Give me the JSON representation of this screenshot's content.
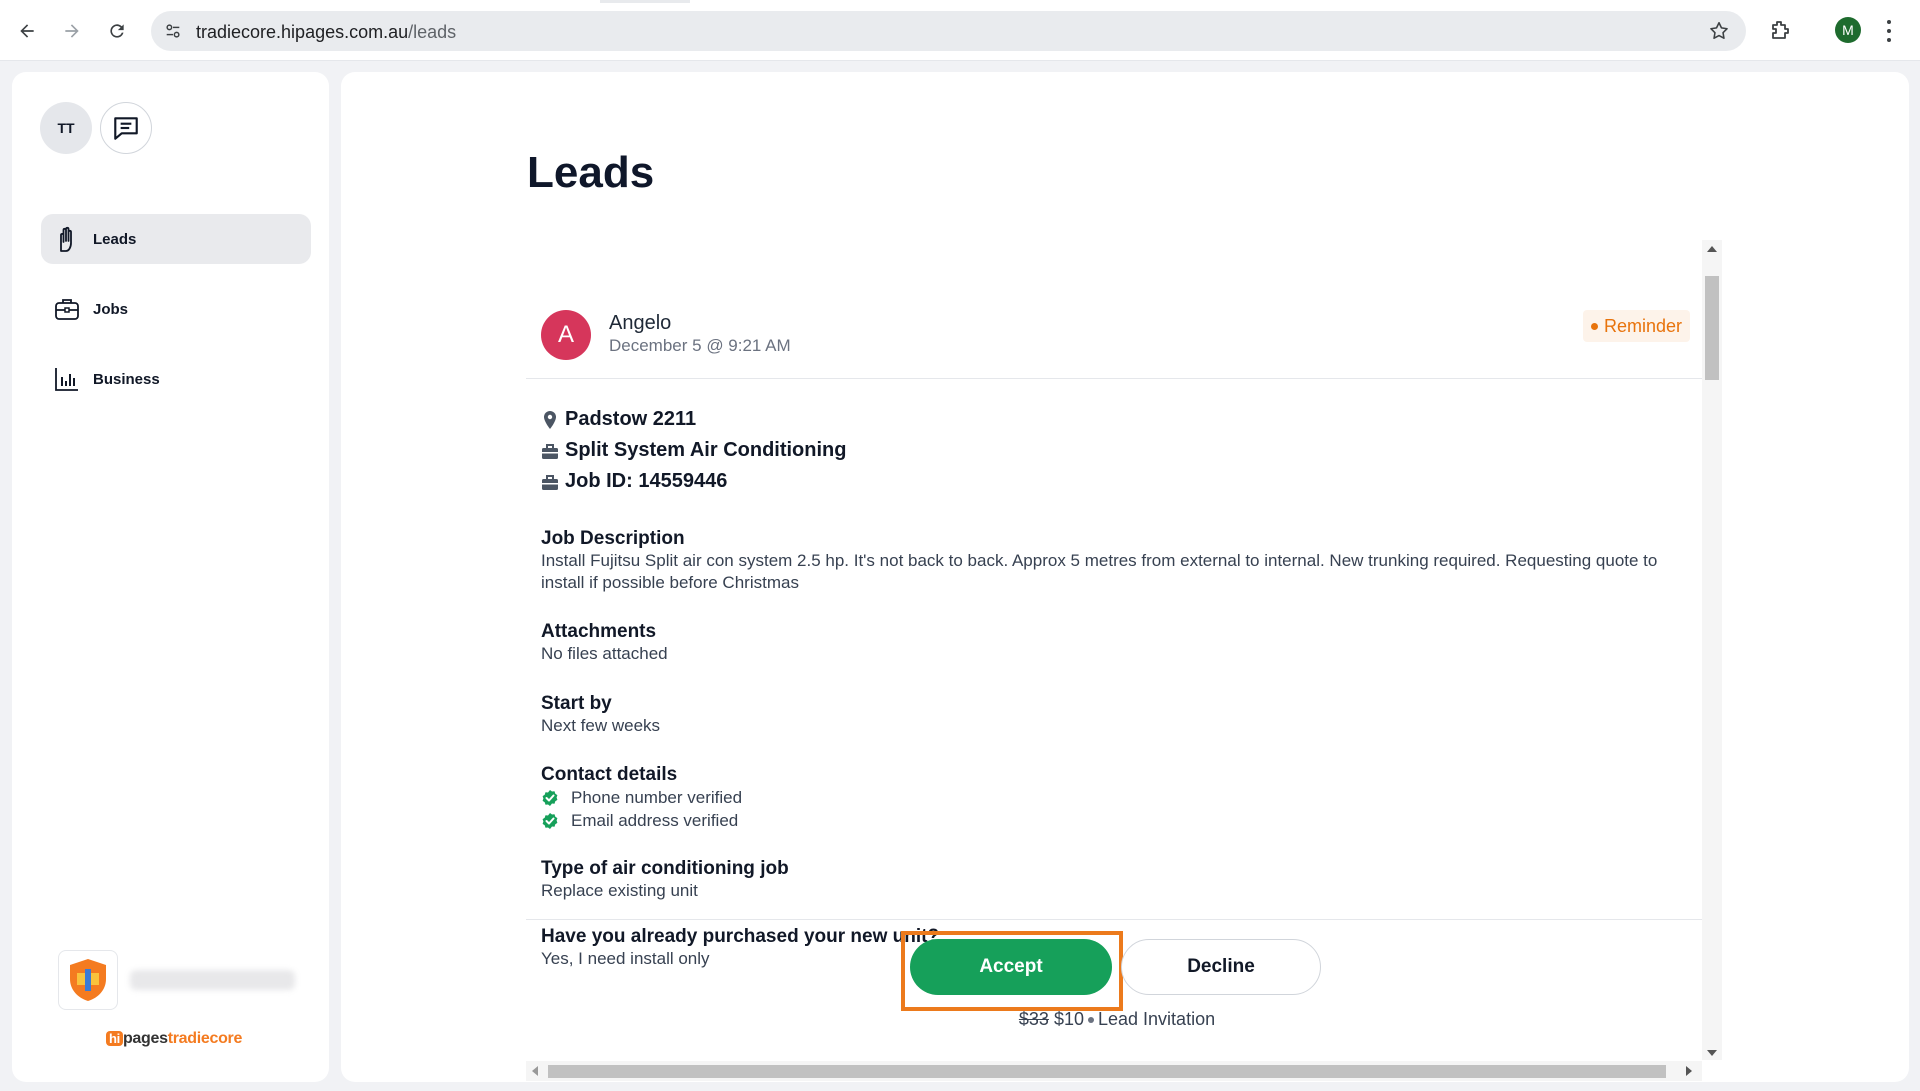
{
  "browser": {
    "url_host": "tradiecore.hipages.com.au",
    "url_path": "/leads",
    "profile_initial": "M",
    "icons": [
      "back-icon",
      "forward-icon",
      "reload-icon",
      "site-settings-icon",
      "star-icon",
      "extensions-icon",
      "menu-icon"
    ]
  },
  "sidebar": {
    "user_initials": "TT",
    "items": [
      {
        "label": "Leads",
        "icon": "hand-icon",
        "active": true
      },
      {
        "label": "Jobs",
        "icon": "briefcase-icon",
        "active": false
      },
      {
        "label": "Business",
        "icon": "bar-chart-icon",
        "active": false
      }
    ],
    "brand": {
      "hi": "hi",
      "pages": "pages",
      "tradiecore": "tradiecore"
    }
  },
  "main": {
    "title": "Leads",
    "lead": {
      "avatar_initial": "A",
      "name": "Angelo",
      "date": "December 5 @ 9:21 AM",
      "reminder": "Reminder",
      "location": "Padstow 2211",
      "category": "Split System Air Conditioning",
      "job_id": "Job ID: 14559446",
      "sections": {
        "description_h": "Job Description",
        "description_b": "Install Fujitsu Split air con system 2.5 hp. It's not back to back. Approx 5 metres from external to internal. New trunking required. Requesting quote to install if possible before Christmas",
        "attachments_h": "Attachments",
        "attachments_b": "No files attached",
        "start_h": "Start by",
        "start_b": "Next few weeks",
        "contact_h": "Contact details",
        "phone": "Phone number verified",
        "email": "Email address verified",
        "type_h": "Type of air conditioning job",
        "type_b": "Replace existing unit",
        "purchased_h": "Have you already purchased your new unit?",
        "purchased_b": "Yes, I need install only"
      },
      "actions": {
        "accept": "Accept",
        "decline": "Decline"
      },
      "pricing": {
        "old": "$33",
        "new": "$10",
        "label": "Lead Invitation"
      }
    }
  },
  "colors": {
    "accent_green": "#16a05a",
    "highlight_orange": "#ec7a1c",
    "avatar_pink": "#d6365b",
    "reminder_orange": "#e8730c"
  }
}
